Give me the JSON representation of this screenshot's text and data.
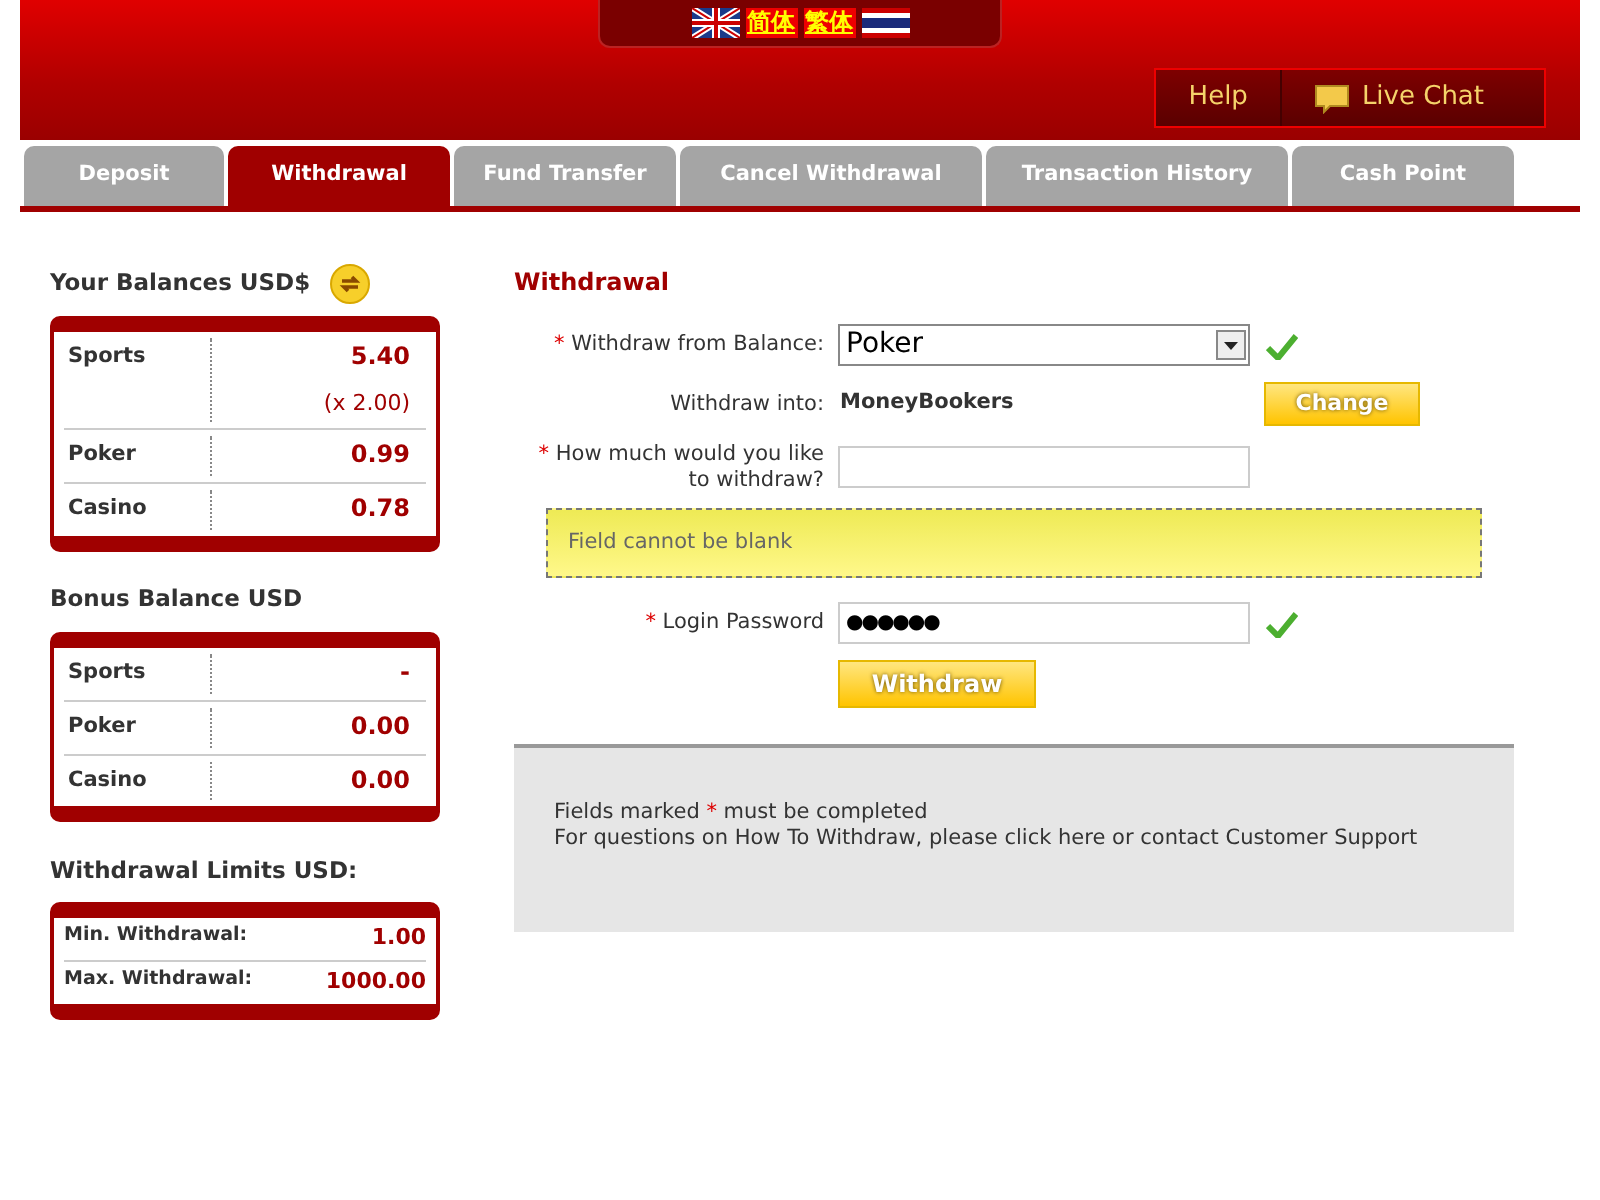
{
  "languages": [
    {
      "kind": "flag-uk"
    },
    {
      "kind": "text",
      "label": "简体"
    },
    {
      "kind": "text",
      "label": "繁体"
    },
    {
      "kind": "flag-th"
    }
  ],
  "header_links": [
    {
      "kind": "text",
      "label": "Help"
    },
    {
      "kind": "chat",
      "label": "Live Chat"
    }
  ],
  "tabs": [
    {
      "label": "Deposit",
      "selected": false
    },
    {
      "label": "Withdrawal",
      "selected": true
    },
    {
      "label": "Fund Transfer",
      "selected": false
    },
    {
      "label": "Cancel Withdrawal",
      "selected": false
    },
    {
      "label": "Transaction History",
      "selected": false
    },
    {
      "label": "Cash Point",
      "selected": false
    }
  ],
  "sidebar": [
    {
      "title": "Your Balances USD$",
      "refresh": true,
      "kind": "balances",
      "rows": [
        {
          "label": "Sports",
          "value": "5.40",
          "note": "(x 2.00)"
        },
        {
          "label": "Poker",
          "value": "0.99"
        },
        {
          "label": "Casino",
          "value": "0.78"
        }
      ]
    },
    {
      "title": "Bonus Balance USD",
      "refresh": false,
      "kind": "balances",
      "rows": [
        {
          "label": "Sports",
          "value": "-"
        },
        {
          "label": "Poker",
          "value": "0.00"
        },
        {
          "label": "Casino",
          "value": "0.00"
        }
      ]
    },
    {
      "title": "Withdrawal Limits USD:",
      "refresh": false,
      "kind": "limits",
      "rows": [
        {
          "label": "Min. Withdrawal:",
          "value": "1.00"
        },
        {
          "label": "Max. Withdrawal:",
          "value": "1000.00"
        }
      ]
    }
  ],
  "form": {
    "title": "Withdrawal",
    "rows": [
      {
        "kind": "select",
        "label": "Withdraw from Balance:",
        "required": true,
        "value": "Poker",
        "valid": true
      },
      {
        "kind": "static",
        "label": "Withdraw into:",
        "required": false,
        "value": "MoneyBookers",
        "button": "Change"
      },
      {
        "kind": "input",
        "label": "How much would you like to withdraw?",
        "required": true,
        "value": "",
        "valid": false
      },
      {
        "kind": "error",
        "message": "Field cannot be blank"
      },
      {
        "kind": "password",
        "label": "Login Password",
        "required": true,
        "value": "●●●●●●",
        "valid": true
      },
      {
        "kind": "submit",
        "button": "Withdraw"
      }
    ]
  },
  "notes": {
    "required_before": "Fields marked",
    "required_mark": "*",
    "required_after": "must be completed",
    "help_before": "For questions on How To Withdraw, please click",
    "help_link": "here",
    "help_middle": "or contact",
    "support_link": "Customer Support"
  }
}
